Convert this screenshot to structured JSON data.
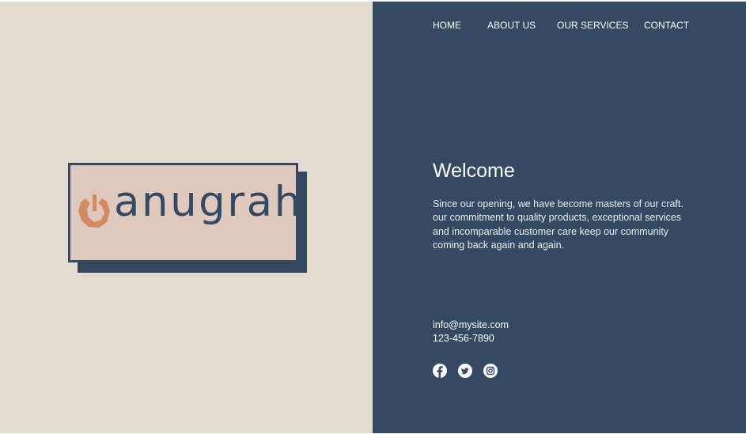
{
  "logo": {
    "wordmark": "anugrah",
    "icon": "logo-mark-icon",
    "accent_color": "#d28a63"
  },
  "nav": {
    "items": [
      {
        "label": "HOME"
      },
      {
        "label": "ABOUT US"
      },
      {
        "label": "OUR SERVICES"
      },
      {
        "label": "CONTACT"
      }
    ]
  },
  "hero": {
    "title": "Welcome",
    "description_lines": [
      "Since our opening, we have become masters of our craft.",
      "our commitment to quality products, exceptional services",
      "and incomparable customer care keep our community",
      "coming back again and again."
    ]
  },
  "contact": {
    "email": "info@mysite.com",
    "phone": "123-456-7890"
  },
  "social": [
    {
      "icon": "facebook-icon"
    },
    {
      "icon": "twitter-icon"
    },
    {
      "icon": "instagram-icon"
    }
  ],
  "colors": {
    "left_bg": "#e4dbd1",
    "right_bg": "#344a63",
    "logo_bg": "#dfc9be",
    "text_light": "#ffffff"
  }
}
